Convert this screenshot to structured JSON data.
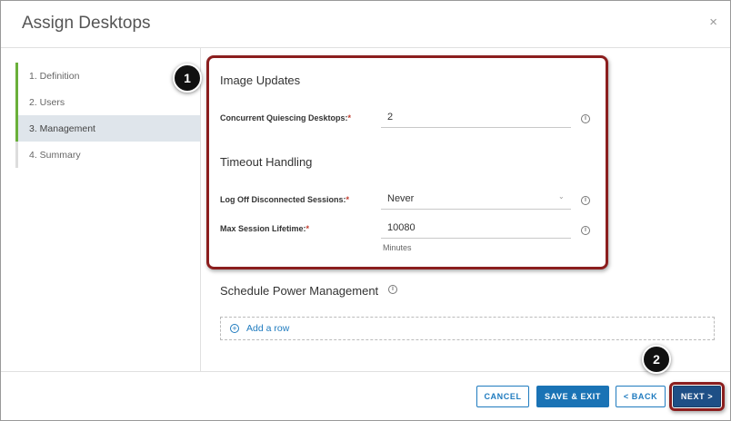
{
  "dialog": {
    "title": "Assign Desktops",
    "close_glyph": "×"
  },
  "steps": [
    {
      "label": "1. Definition"
    },
    {
      "label": "2. Users"
    },
    {
      "label": "3. Management"
    },
    {
      "label": "4. Summary"
    }
  ],
  "image_updates": {
    "title": "Image Updates",
    "concurrent_label": "Concurrent Quiescing Desktops:",
    "concurrent_value": "2"
  },
  "timeout": {
    "title": "Timeout Handling",
    "logoff_label": "Log Off Disconnected Sessions:",
    "logoff_value": "Never",
    "lifetime_label": "Max Session Lifetime:",
    "lifetime_value": "10080",
    "lifetime_unit": "Minutes"
  },
  "schedule": {
    "title": "Schedule Power Management",
    "add_row_label": "Add a row"
  },
  "footer": {
    "cancel": "CANCEL",
    "save_exit": "SAVE & EXIT",
    "back": "< BACK",
    "next": "NEXT >"
  },
  "callouts": {
    "one": "1",
    "two": "2"
  },
  "common": {
    "required_mark": "*",
    "info_glyph": "i",
    "chevron_glyph": "⌄",
    "plus_glyph": "+"
  },
  "colors": {
    "accent_blue": "#1a73b5",
    "callout_red": "#8b1e1e",
    "step_green": "#6ab03a"
  }
}
